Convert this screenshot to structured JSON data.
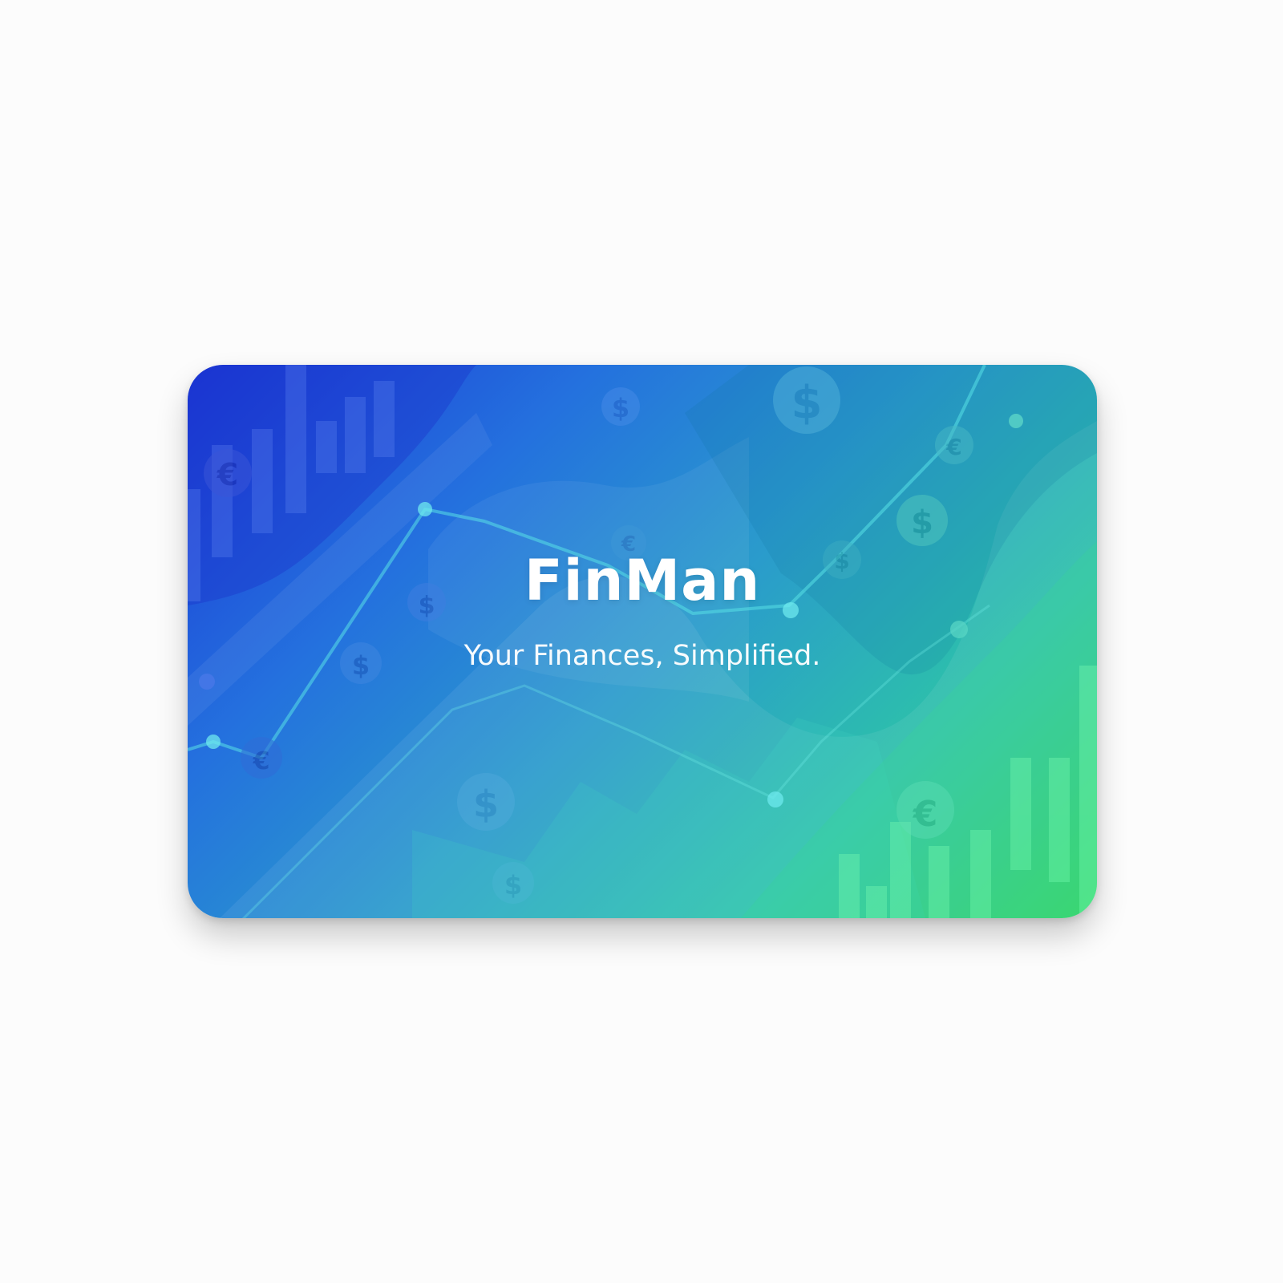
{
  "card": {
    "brand_name": "FinMan",
    "tagline": "Your Finances, Simplified.",
    "gradient": [
      "#1b37d6",
      "#2471de",
      "#2a9bcc",
      "#2dc1aa",
      "#2ed35e"
    ]
  },
  "page": {
    "background": "#fcfcfc"
  },
  "decorations": {
    "icons": [
      "euro-coin-icon",
      "dollar-coin-icon",
      "bar-chart-icon",
      "trend-line-icon"
    ]
  }
}
